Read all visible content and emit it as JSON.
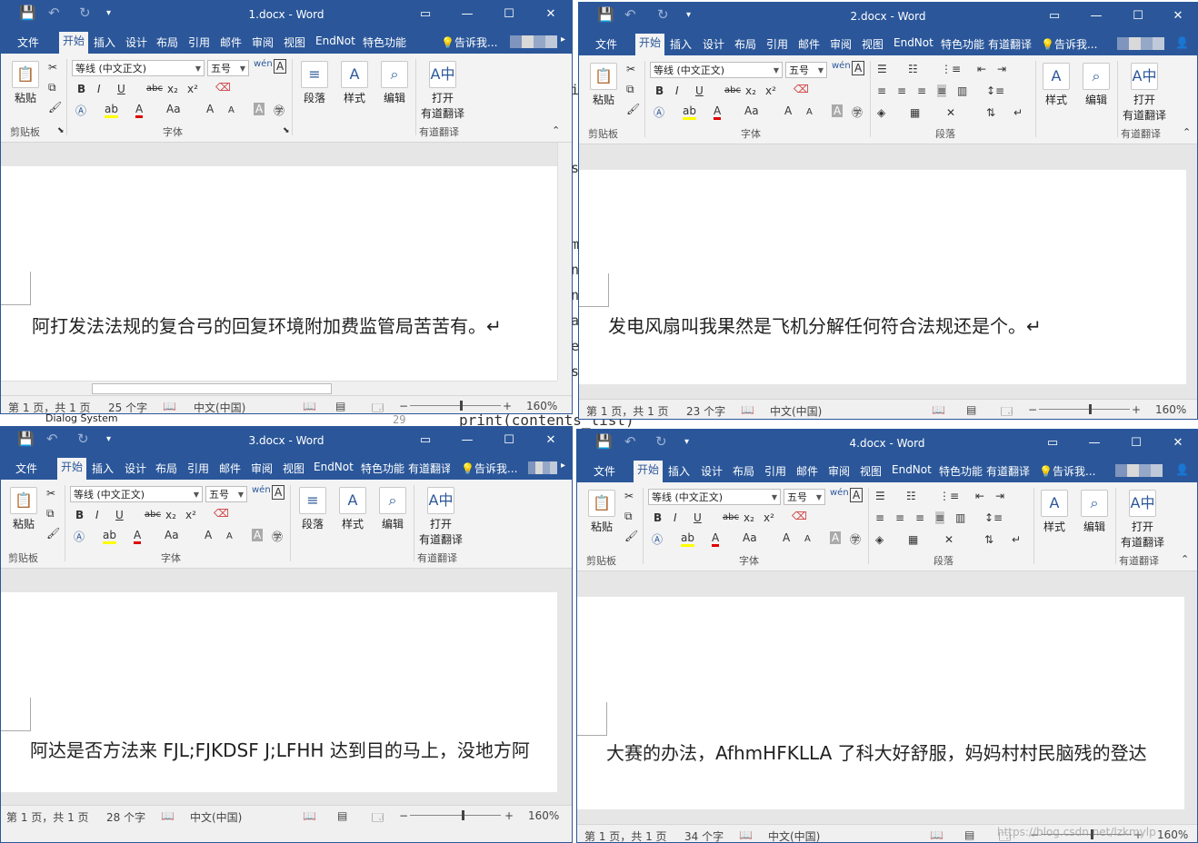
{
  "background": {
    "code_fragments": [
      "i",
      "s",
      "m",
      "n",
      "n",
      "a",
      "e",
      "s"
    ],
    "behind_text": "print(contents_list)",
    "line_number": "29",
    "dialog_label": "Dialog System"
  },
  "ribbon": {
    "tabs": [
      "文件",
      "开始",
      "插入",
      "设计",
      "布局",
      "引用",
      "邮件",
      "审阅",
      "视图",
      "EndNot",
      "特色功能",
      "有道翻译"
    ],
    "tell_me": "告诉我...",
    "font_name": "等线 (中文正文)",
    "font_size": "五号",
    "paste_label": "粘贴",
    "clipboard_label": "剪贴板",
    "font_label": "字体",
    "paragraph_label": "段落",
    "styles_label": "样式",
    "editing_label": "编辑",
    "translate_label_1": "打开",
    "translate_label_2": "有道翻译",
    "translate_group": "有道翻译",
    "bold": "B",
    "italic": "I",
    "underline": "U",
    "strike": "abc",
    "sub": "x₂",
    "sup": "x²",
    "aa": "Aa",
    "grow": "A",
    "shrink": "A",
    "wen": "wén"
  },
  "status_common": {
    "language": "中文(中国)",
    "zoom": "160%"
  },
  "windows": [
    {
      "title": "1.docx - Word",
      "page_info": "第 1 页，共 1 页",
      "word_count": "25 个字",
      "text": "阿打发法法规的复合弓的回复环境附加费监管局苦苦有。↵"
    },
    {
      "title": "2.docx - Word",
      "page_info": "第 1 页，共 1 页",
      "word_count": "23 个字",
      "text": "发电风扇叫我果然是飞机分解任何符合法规还是个。↵"
    },
    {
      "title": "3.docx - Word",
      "page_info": "第 1 页，共 1 页",
      "word_count": "28 个字",
      "text": "阿达是否方法来 FJL;FJKDSF J;LFHH 达到目的马上，没地方阿"
    },
    {
      "title": "4.docx - Word",
      "page_info": "第 1 页，共 1 页",
      "word_count": "34 个字",
      "text": "大赛的办法，AfhmHFKLLA 了科大好舒服，妈妈村村民脑残的登达"
    }
  ],
  "watermark": "https://blog.csdn.net/lzkmylp",
  "colors": {
    "word_blue": "#2b579a",
    "ribbon_bg": "#f3f3f3",
    "highlight_yellow": "#ffff00",
    "font_red": "#e00000"
  }
}
